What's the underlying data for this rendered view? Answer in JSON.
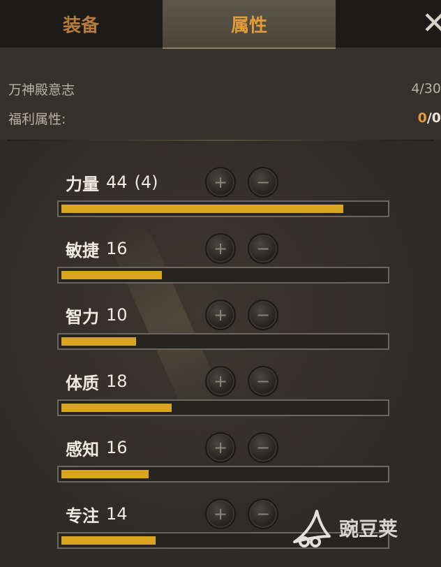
{
  "tabs": [
    {
      "label": "装备",
      "active": false
    },
    {
      "label": "属性",
      "active": true
    }
  ],
  "close_icon": "close-icon",
  "info": {
    "will_label": "万神殿意志",
    "will_value": "4/30",
    "bonus_label": "福利属性:",
    "bonus_current": "0",
    "bonus_sep": "/",
    "bonus_max": "0"
  },
  "stats": [
    {
      "name": "力量",
      "value": "44",
      "bonus": "(4)",
      "fill_fraction": 0.87
    },
    {
      "name": "敏捷",
      "value": "16",
      "bonus": "",
      "fill_fraction": 0.31
    },
    {
      "name": "智力",
      "value": "10",
      "bonus": "",
      "fill_fraction": 0.23
    },
    {
      "name": "体质",
      "value": "18",
      "bonus": "",
      "fill_fraction": 0.34
    },
    {
      "name": "感知",
      "value": "16",
      "bonus": "",
      "fill_fraction": 0.27
    },
    {
      "name": "专注",
      "value": "14",
      "bonus": "",
      "fill_fraction": 0.29
    }
  ],
  "buttons": {
    "plus": "+",
    "minus": "−"
  },
  "watermark": {
    "text": "豌豆荚"
  },
  "colors": {
    "bar_fill": "#dba61f",
    "active_tab": "#e39b3a",
    "inactive_tab": "#b47a3e"
  }
}
